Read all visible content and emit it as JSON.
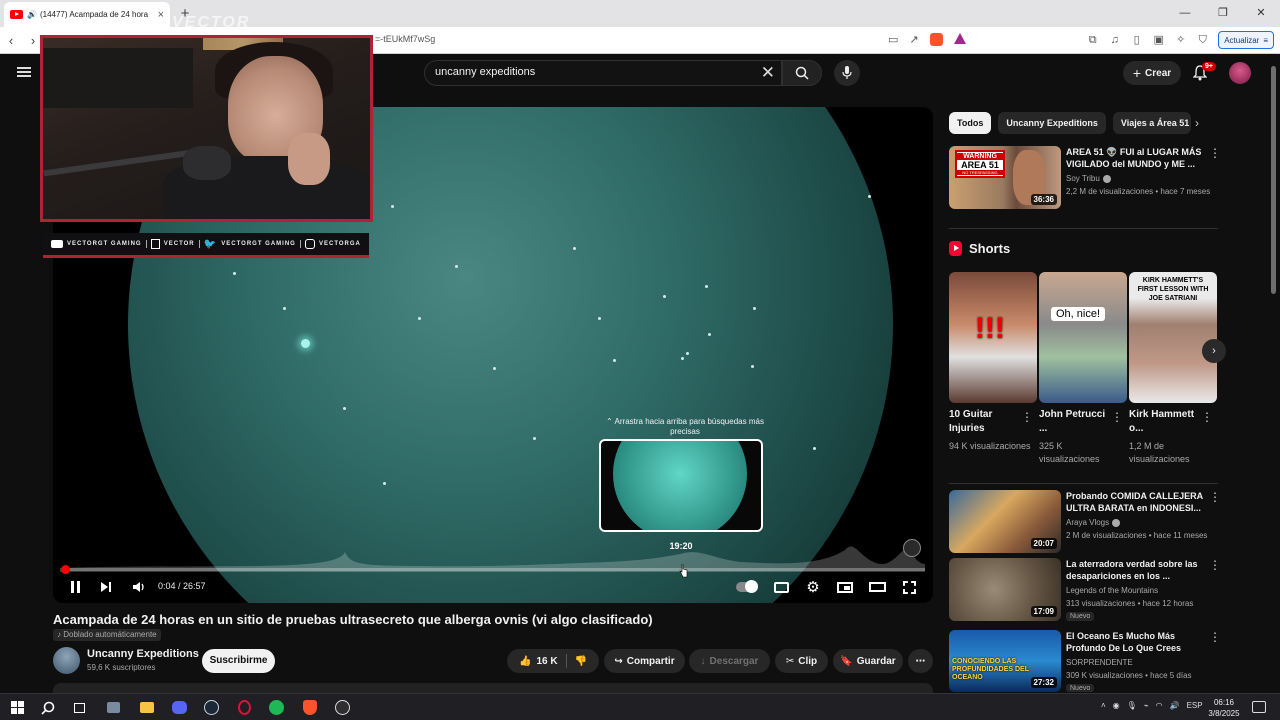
{
  "browser": {
    "tab_title": "(14477) Acampada de 24 hora",
    "url": "=-tEUkMf7wSg",
    "update_label": "Actualizar"
  },
  "header": {
    "search_value": "uncanny expeditions",
    "create_label": "Crear",
    "notif_count": "9+"
  },
  "overlay": {
    "logo": "VECTOR",
    "social": [
      {
        "icon": "youtube-icon",
        "label": "VECTORGT GAMING"
      },
      {
        "icon": "twitch-icon",
        "label": "VECTOR"
      },
      {
        "icon": "twitter-icon",
        "label": "VECTORGT GAMING"
      },
      {
        "icon": "instagram-icon",
        "label": "VECTORGA"
      }
    ]
  },
  "player": {
    "hint": "Arrastra hacia arriba para búsquedas más precisas",
    "preview_time": "19:20",
    "current_time": "0:04",
    "duration": "26:57",
    "time_display": "0:04 / 26:57",
    "progress_fraction": 0.0025,
    "hover_fraction": 0.71
  },
  "video": {
    "title": "Acampada de 24 horas en un sitio de pruebas ultrasecreto que alberga ovnis (vi algo clasificado)",
    "dub_label": "Doblado automáticamente",
    "channel": "Uncanny Expeditions",
    "subscribers": "59,6 K suscriptores",
    "subscribe_label": "Suscribirme",
    "likes": "16 K",
    "share_label": "Compartir",
    "download_label": "Descargar",
    "clip_label": "Clip",
    "save_label": "Guardar"
  },
  "chips": [
    "Todos",
    "Uncanny Expeditions",
    "Viajes a Área 51"
  ],
  "related_top": {
    "title": "AREA 51 👽 FUI al LUGAR MÁS VIGILADO del MUNDO y ME ...",
    "channel": "Soy Tribu",
    "meta": "2,2 M de visualizaciones • hace 7 meses",
    "duration": "36:36",
    "thumb_text_1": "WARNING",
    "thumb_text_2": "AREA 51",
    "thumb_text_3": "NO TRESPASSING"
  },
  "shorts": {
    "heading": "Shorts",
    "items": [
      {
        "title": "10 Guitar Injuries",
        "views": "94 K visualizaciones",
        "overlay": "!!!"
      },
      {
        "title": "John Petrucci ...",
        "views": "325 K visualizaciones",
        "overlay": "Oh, nice!"
      },
      {
        "title": "Kirk Hammett o...",
        "views": "1,2 M de visualizaciones",
        "overlay": "KIRK HAMMETT'S FIRST LESSON WITH JOE SATRIANI"
      }
    ]
  },
  "related": [
    {
      "title": "Probando COMIDA CALLEJERA ULTRA BARATA en INDONESI...",
      "channel": "Araya Vlogs",
      "verified": true,
      "meta": "2 M de visualizaciones • hace 11 meses",
      "duration": "20:07",
      "new": ""
    },
    {
      "title": "La aterradora verdad sobre las desapariciones en los ...",
      "channel": "Legends of the Mountains",
      "verified": false,
      "meta": "313 visualizaciones • hace 12 horas",
      "duration": "17:09",
      "new": "Nuevo"
    },
    {
      "title": "El Oceano Es Mucho Más Profundo De Lo Que Crees",
      "channel": "SORPRENDENTE",
      "verified": false,
      "meta": "309 K visualizaciones • hace 5 días",
      "duration": "27:32",
      "new": "Nuevo",
      "thumb_text": "CONOCIENDO LAS PROFUNDIDADES DEL OCEANO"
    }
  ],
  "taskbar": {
    "lang": "ESP",
    "time": "06:16",
    "date": "3/8/2025"
  }
}
